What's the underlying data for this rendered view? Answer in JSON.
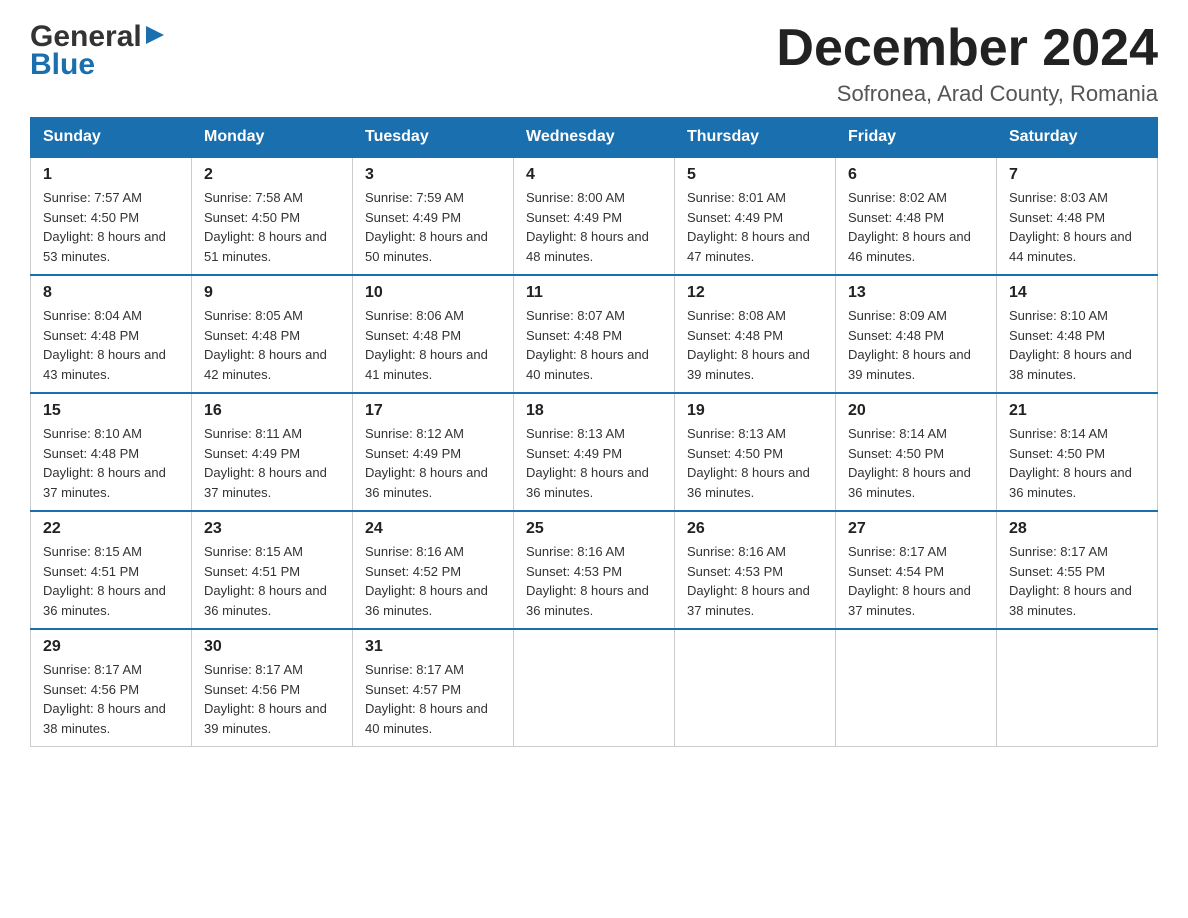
{
  "logo": {
    "line1": "General",
    "line2": "Blue"
  },
  "title": "December 2024",
  "subtitle": "Sofronea, Arad County, Romania",
  "days_of_week": [
    "Sunday",
    "Monday",
    "Tuesday",
    "Wednesday",
    "Thursday",
    "Friday",
    "Saturday"
  ],
  "weeks": [
    [
      {
        "day": "1",
        "sunrise": "Sunrise: 7:57 AM",
        "sunset": "Sunset: 4:50 PM",
        "daylight": "Daylight: 8 hours and 53 minutes."
      },
      {
        "day": "2",
        "sunrise": "Sunrise: 7:58 AM",
        "sunset": "Sunset: 4:50 PM",
        "daylight": "Daylight: 8 hours and 51 minutes."
      },
      {
        "day": "3",
        "sunrise": "Sunrise: 7:59 AM",
        "sunset": "Sunset: 4:49 PM",
        "daylight": "Daylight: 8 hours and 50 minutes."
      },
      {
        "day": "4",
        "sunrise": "Sunrise: 8:00 AM",
        "sunset": "Sunset: 4:49 PM",
        "daylight": "Daylight: 8 hours and 48 minutes."
      },
      {
        "day": "5",
        "sunrise": "Sunrise: 8:01 AM",
        "sunset": "Sunset: 4:49 PM",
        "daylight": "Daylight: 8 hours and 47 minutes."
      },
      {
        "day": "6",
        "sunrise": "Sunrise: 8:02 AM",
        "sunset": "Sunset: 4:48 PM",
        "daylight": "Daylight: 8 hours and 46 minutes."
      },
      {
        "day": "7",
        "sunrise": "Sunrise: 8:03 AM",
        "sunset": "Sunset: 4:48 PM",
        "daylight": "Daylight: 8 hours and 44 minutes."
      }
    ],
    [
      {
        "day": "8",
        "sunrise": "Sunrise: 8:04 AM",
        "sunset": "Sunset: 4:48 PM",
        "daylight": "Daylight: 8 hours and 43 minutes."
      },
      {
        "day": "9",
        "sunrise": "Sunrise: 8:05 AM",
        "sunset": "Sunset: 4:48 PM",
        "daylight": "Daylight: 8 hours and 42 minutes."
      },
      {
        "day": "10",
        "sunrise": "Sunrise: 8:06 AM",
        "sunset": "Sunset: 4:48 PM",
        "daylight": "Daylight: 8 hours and 41 minutes."
      },
      {
        "day": "11",
        "sunrise": "Sunrise: 8:07 AM",
        "sunset": "Sunset: 4:48 PM",
        "daylight": "Daylight: 8 hours and 40 minutes."
      },
      {
        "day": "12",
        "sunrise": "Sunrise: 8:08 AM",
        "sunset": "Sunset: 4:48 PM",
        "daylight": "Daylight: 8 hours and 39 minutes."
      },
      {
        "day": "13",
        "sunrise": "Sunrise: 8:09 AM",
        "sunset": "Sunset: 4:48 PM",
        "daylight": "Daylight: 8 hours and 39 minutes."
      },
      {
        "day": "14",
        "sunrise": "Sunrise: 8:10 AM",
        "sunset": "Sunset: 4:48 PM",
        "daylight": "Daylight: 8 hours and 38 minutes."
      }
    ],
    [
      {
        "day": "15",
        "sunrise": "Sunrise: 8:10 AM",
        "sunset": "Sunset: 4:48 PM",
        "daylight": "Daylight: 8 hours and 37 minutes."
      },
      {
        "day": "16",
        "sunrise": "Sunrise: 8:11 AM",
        "sunset": "Sunset: 4:49 PM",
        "daylight": "Daylight: 8 hours and 37 minutes."
      },
      {
        "day": "17",
        "sunrise": "Sunrise: 8:12 AM",
        "sunset": "Sunset: 4:49 PM",
        "daylight": "Daylight: 8 hours and 36 minutes."
      },
      {
        "day": "18",
        "sunrise": "Sunrise: 8:13 AM",
        "sunset": "Sunset: 4:49 PM",
        "daylight": "Daylight: 8 hours and 36 minutes."
      },
      {
        "day": "19",
        "sunrise": "Sunrise: 8:13 AM",
        "sunset": "Sunset: 4:50 PM",
        "daylight": "Daylight: 8 hours and 36 minutes."
      },
      {
        "day": "20",
        "sunrise": "Sunrise: 8:14 AM",
        "sunset": "Sunset: 4:50 PM",
        "daylight": "Daylight: 8 hours and 36 minutes."
      },
      {
        "day": "21",
        "sunrise": "Sunrise: 8:14 AM",
        "sunset": "Sunset: 4:50 PM",
        "daylight": "Daylight: 8 hours and 36 minutes."
      }
    ],
    [
      {
        "day": "22",
        "sunrise": "Sunrise: 8:15 AM",
        "sunset": "Sunset: 4:51 PM",
        "daylight": "Daylight: 8 hours and 36 minutes."
      },
      {
        "day": "23",
        "sunrise": "Sunrise: 8:15 AM",
        "sunset": "Sunset: 4:51 PM",
        "daylight": "Daylight: 8 hours and 36 minutes."
      },
      {
        "day": "24",
        "sunrise": "Sunrise: 8:16 AM",
        "sunset": "Sunset: 4:52 PM",
        "daylight": "Daylight: 8 hours and 36 minutes."
      },
      {
        "day": "25",
        "sunrise": "Sunrise: 8:16 AM",
        "sunset": "Sunset: 4:53 PM",
        "daylight": "Daylight: 8 hours and 36 minutes."
      },
      {
        "day": "26",
        "sunrise": "Sunrise: 8:16 AM",
        "sunset": "Sunset: 4:53 PM",
        "daylight": "Daylight: 8 hours and 37 minutes."
      },
      {
        "day": "27",
        "sunrise": "Sunrise: 8:17 AM",
        "sunset": "Sunset: 4:54 PM",
        "daylight": "Daylight: 8 hours and 37 minutes."
      },
      {
        "day": "28",
        "sunrise": "Sunrise: 8:17 AM",
        "sunset": "Sunset: 4:55 PM",
        "daylight": "Daylight: 8 hours and 38 minutes."
      }
    ],
    [
      {
        "day": "29",
        "sunrise": "Sunrise: 8:17 AM",
        "sunset": "Sunset: 4:56 PM",
        "daylight": "Daylight: 8 hours and 38 minutes."
      },
      {
        "day": "30",
        "sunrise": "Sunrise: 8:17 AM",
        "sunset": "Sunset: 4:56 PM",
        "daylight": "Daylight: 8 hours and 39 minutes."
      },
      {
        "day": "31",
        "sunrise": "Sunrise: 8:17 AM",
        "sunset": "Sunset: 4:57 PM",
        "daylight": "Daylight: 8 hours and 40 minutes."
      },
      null,
      null,
      null,
      null
    ]
  ]
}
